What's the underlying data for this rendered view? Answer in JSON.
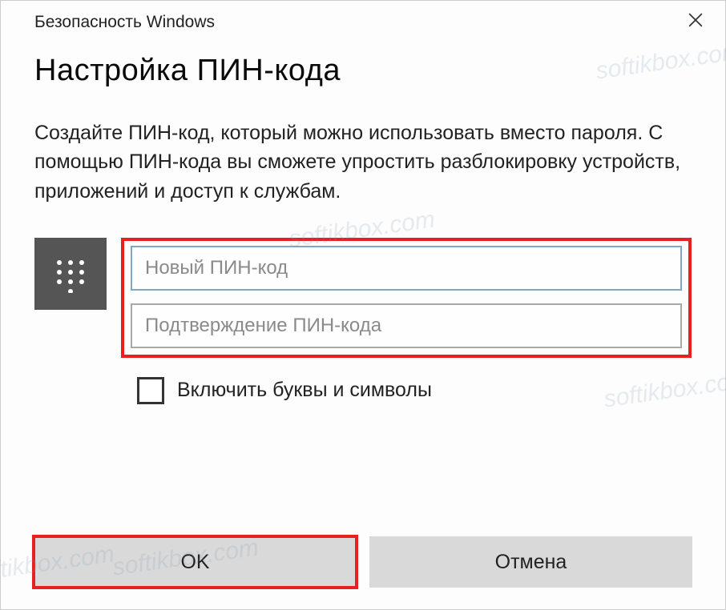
{
  "titlebar": {
    "title": "Безопасность Windows"
  },
  "dialog": {
    "heading": "Настройка ПИН-кода",
    "description": "Создайте ПИН-код, который можно использовать вместо пароля. С помощью ПИН-кода вы сможете упростить разблокировку устройств, приложений и доступ к службам."
  },
  "inputs": {
    "new_pin_placeholder": "Новый ПИН-код",
    "new_pin_value": "",
    "confirm_pin_placeholder": "Подтверждение ПИН-кода",
    "confirm_pin_value": ""
  },
  "checkbox": {
    "label": "Включить буквы и символы",
    "checked": false
  },
  "buttons": {
    "ok": "OK",
    "cancel": "Отмена"
  },
  "watermark": "softikbox.com"
}
